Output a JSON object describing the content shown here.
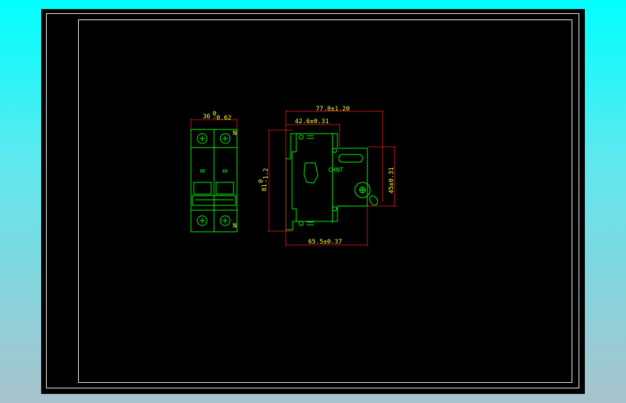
{
  "drawing": {
    "front_view": {
      "width_dim": "36",
      "width_tol_upper": "0",
      "width_tol_lower": "-0.62",
      "terminal_label": "N"
    },
    "side_view": {
      "brand_label": "CHNT",
      "overall_depth_dim": "77.8±1.20",
      "rail_to_front_dim": "42.6±0.31",
      "height_dim": "81",
      "height_tol_upper": "0",
      "height_tol_lower": "-1.2",
      "front_height_dim": "45±0.31",
      "base_depth_dim": "65.5±0.37"
    }
  },
  "colors": {
    "outline": "#00ff00",
    "dimension": "#ff2020",
    "text": "#ffff40",
    "background": "#000000"
  }
}
